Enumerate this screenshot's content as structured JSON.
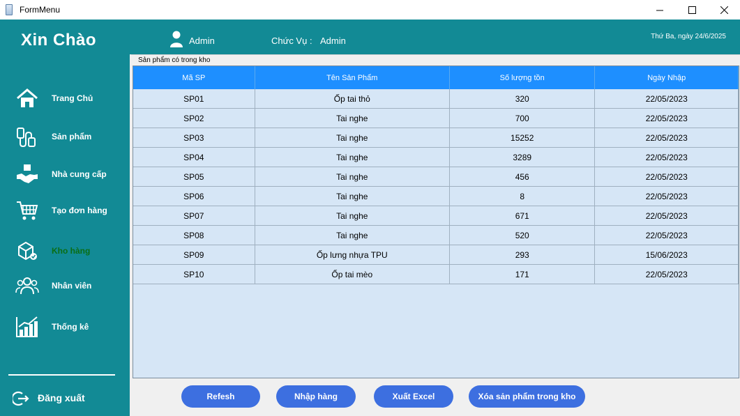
{
  "window": {
    "title": "FormMenu"
  },
  "header": {
    "greeting": "Xin Chào",
    "user_name": "Admin",
    "role_label": "Chức Vụ :",
    "role_value": "Admin",
    "date": "Thứ Ba, ngày 24/6/2025"
  },
  "sidebar": {
    "items": [
      {
        "label": "Trang Chủ",
        "icon": "home-icon"
      },
      {
        "label": "Sản phẩm",
        "icon": "products-icon"
      },
      {
        "label": "Nhà cung cấp",
        "icon": "supplier-handshake-icon"
      },
      {
        "label": "Tạo đơn hàng",
        "icon": "cart-icon"
      },
      {
        "label": "Kho hàng",
        "icon": "warehouse-icon"
      },
      {
        "label": "Nhân viên",
        "icon": "employees-icon"
      },
      {
        "label": "Thống kê",
        "icon": "statistics-chart-icon"
      }
    ],
    "active_item": "Kho hàng",
    "logout_label": "Đăng xuất"
  },
  "inventory": {
    "group_title": "Sản phẩm có trong kho",
    "columns": [
      "Mã SP",
      "Tên Sản Phẩm",
      "Số lượng tồn",
      "Ngày Nhập"
    ],
    "rows": [
      [
        "SP01",
        "Ốp tai thỏ",
        "320",
        "22/05/2023"
      ],
      [
        "SP02",
        "Tai nghe",
        "700",
        "22/05/2023"
      ],
      [
        "SP03",
        "Tai nghe",
        "15252",
        "22/05/2023"
      ],
      [
        "SP04",
        "Tai nghe",
        "3289",
        "22/05/2023"
      ],
      [
        "SP05",
        "Tai nghe",
        "456",
        "22/05/2023"
      ],
      [
        "SP06",
        "Tai nghe",
        "8",
        "22/05/2023"
      ],
      [
        "SP07",
        "Tai nghe",
        "671",
        "22/05/2023"
      ],
      [
        "SP08",
        "Tai nghe",
        "520",
        "22/05/2023"
      ],
      [
        "SP09",
        "Ốp lưng nhựa TPU",
        "293",
        "15/06/2023"
      ],
      [
        "SP10",
        "Ốp tai mèo",
        "171",
        "22/05/2023"
      ]
    ]
  },
  "actions": {
    "refresh": "Refesh",
    "import": "Nhập hàng",
    "export_excel": "Xuất Excel",
    "delete": "Xóa sản phẩm trong kho"
  },
  "colors": {
    "teal": "#128a95",
    "header_blue": "#1e8fff",
    "grid_bg": "#d6e6f6",
    "button_blue": "#3d6fe0",
    "active_text": "#0a6e14"
  }
}
